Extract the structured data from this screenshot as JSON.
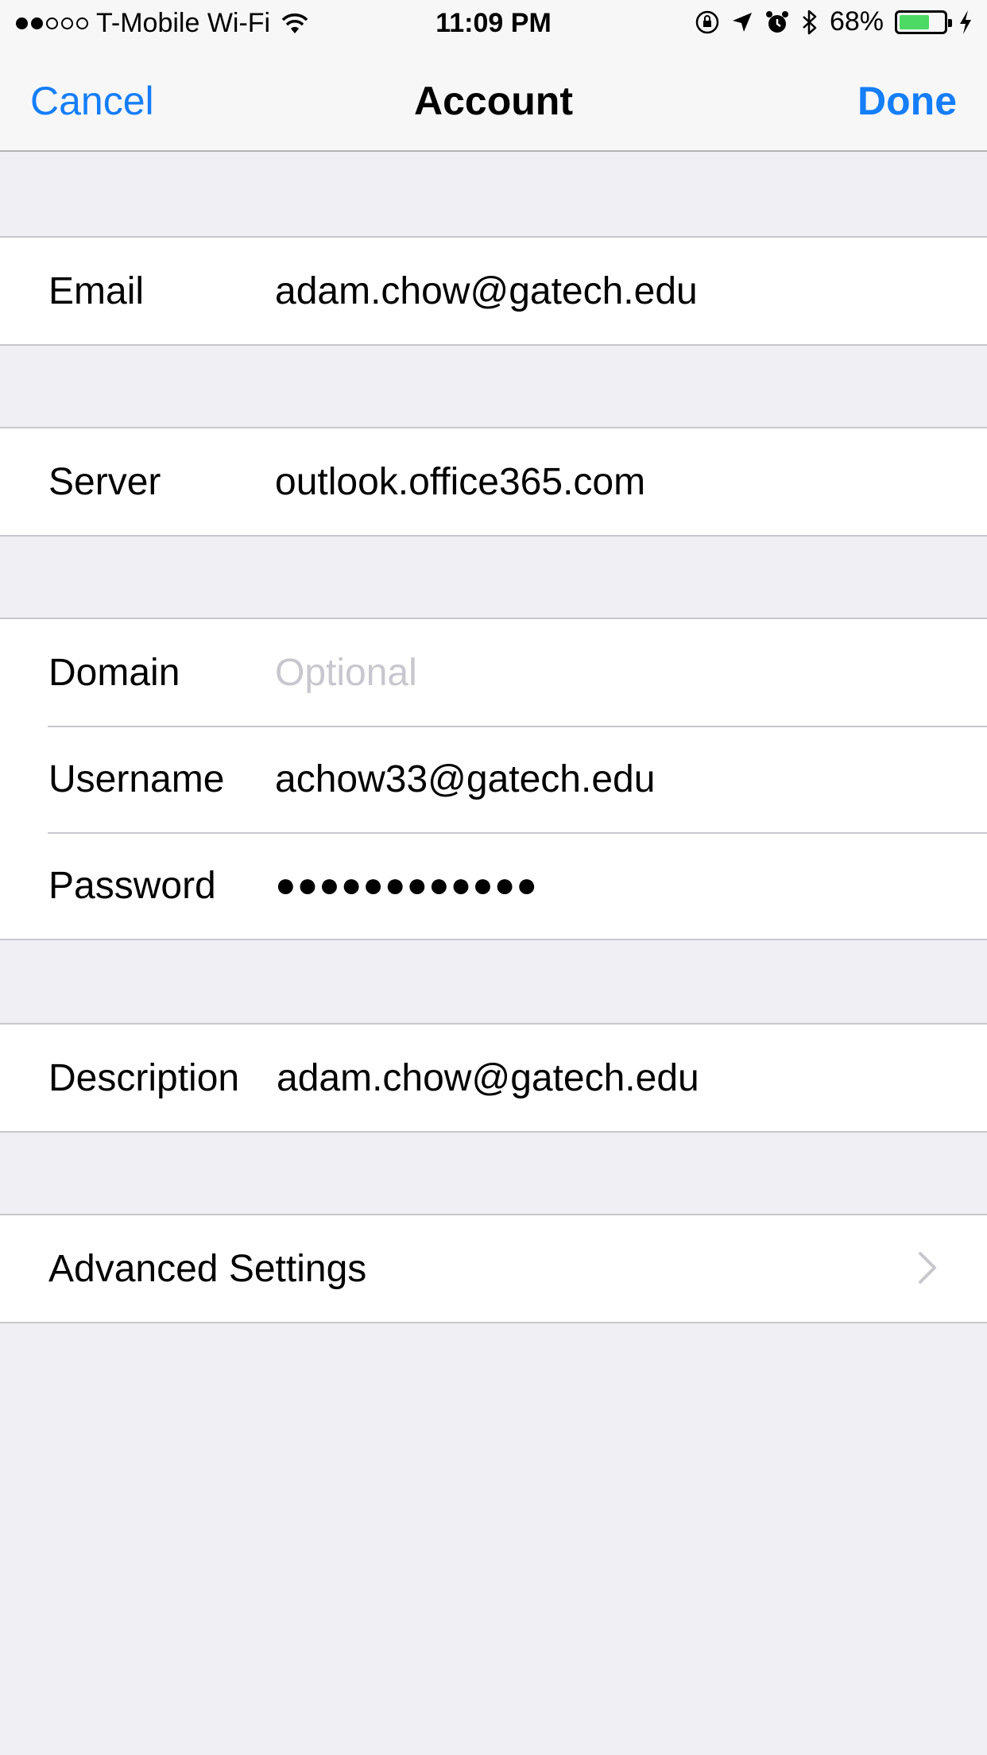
{
  "status_bar": {
    "signal_bars": 2,
    "carrier": "T-Mobile Wi-Fi",
    "time": "11:09 PM",
    "battery_percent": "68%",
    "battery_level": 0.68,
    "icons": [
      "wifi-icon",
      "rotation-lock-icon",
      "location-icon",
      "alarm-icon",
      "bluetooth-icon",
      "charging-icon"
    ]
  },
  "nav": {
    "cancel": "Cancel",
    "title": "Account",
    "done": "Done",
    "accent": "#157efb"
  },
  "email": {
    "label": "Email",
    "value": "adam.chow@gatech.edu"
  },
  "server": {
    "label": "Server",
    "value": "outlook.office365.com"
  },
  "domain": {
    "label": "Domain",
    "placeholder": "Optional"
  },
  "username": {
    "label": "Username",
    "value": "achow33@gatech.edu"
  },
  "password": {
    "label": "Password",
    "value": "●●●●●●●●●●●●"
  },
  "description": {
    "label": "Description",
    "value": "adam.chow@gatech.edu"
  },
  "advanced": {
    "label": "Advanced Settings"
  }
}
